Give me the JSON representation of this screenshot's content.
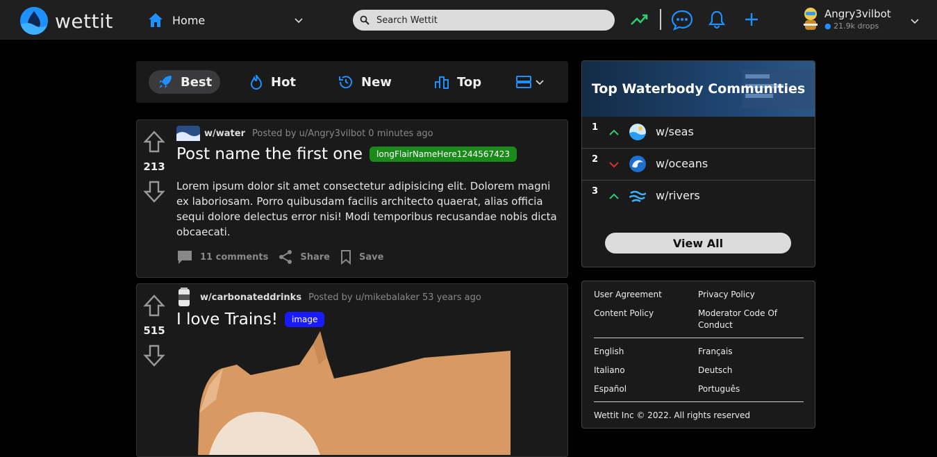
{
  "app": {
    "name": "wettit"
  },
  "header": {
    "home_label": "Home",
    "search_placeholder": "Search Wettit",
    "user": {
      "name": "Angry3vilbot",
      "drops": "21.9k drops"
    }
  },
  "sort": {
    "items": [
      "Best",
      "Hot",
      "New",
      "Top"
    ],
    "active": "Best"
  },
  "posts": [
    {
      "community": "w/water",
      "posted_by": "Posted by u/Angry3vilbot 0 minutes ago",
      "votes": "213",
      "title": "Post name the first one",
      "flair": "longFlairNameHere1244567423",
      "flair_color": "#1a8a1a",
      "body": "Lorem ipsum dolor sit amet consectetur adipisicing elit. Dolorem magni ex laboriosam. Porro quibusdam facilis architecto quaerat, alias officia sequi dolore delectus error nisi! Modi temporibus recusandae nobis dicta obcaecati.",
      "comments": "11 comments",
      "share": "Share",
      "save": "Save"
    },
    {
      "community": "w/carbonateddrinks",
      "posted_by": "Posted by u/mikebalaker 53 years ago",
      "votes": "515",
      "title": "I love Trains!",
      "flair": "image",
      "flair_color": "#1a1aff"
    }
  ],
  "communities": {
    "title": "Top Waterbody Communities",
    "items": [
      {
        "rank": "1",
        "trend": "up",
        "name": "w/seas"
      },
      {
        "rank": "2",
        "trend": "down",
        "name": "w/oceans"
      },
      {
        "rank": "3",
        "trend": "up",
        "name": "w/rivers"
      }
    ],
    "view_all": "View All"
  },
  "footer": {
    "user_agreement": "User Agreement",
    "privacy_policy": "Privacy Policy",
    "content_policy": "Content Policy",
    "moderator_code": "Moderator Code Of Conduct",
    "languages": [
      "English",
      "Français",
      "Italiano",
      "Deutsch",
      "Español",
      "Português"
    ],
    "copyright": "Wettit Inc © 2022. All rights reserved"
  },
  "colors": {
    "accent": "#1e90ff",
    "up": "#2ecc71",
    "down": "#e03131"
  }
}
